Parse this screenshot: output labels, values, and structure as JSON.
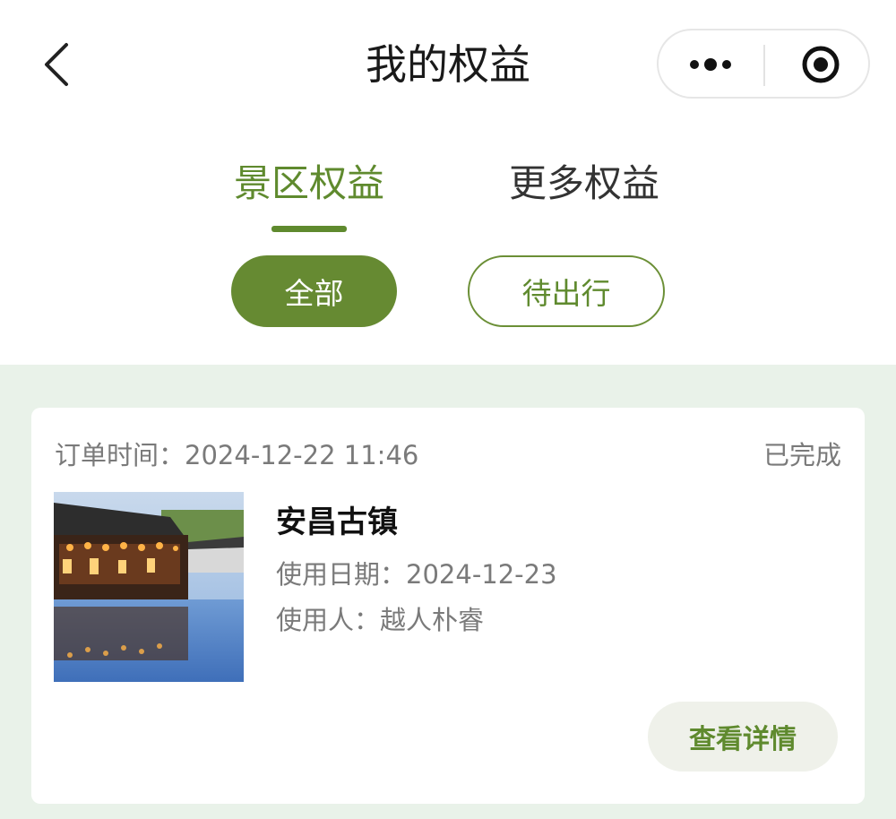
{
  "header": {
    "title": "我的权益",
    "back_icon": "chevron-left-icon",
    "more_icon": "more-dots-icon",
    "target_icon": "target-icon"
  },
  "tabs": [
    {
      "label": "景区权益",
      "active": true
    },
    {
      "label": "更多权益",
      "active": false
    }
  ],
  "filters": [
    {
      "label": "全部",
      "selected": true
    },
    {
      "label": "待出行",
      "selected": false
    }
  ],
  "colors": {
    "accent": "#5f8a2e",
    "pill_fill": "#668a32",
    "list_bg": "#e9f2e9"
  },
  "orders": [
    {
      "time_label": "订单时间：",
      "time_value": "2024-12-22 11:46",
      "status": "已完成",
      "name": "安昌古镇",
      "use_date_label": "使用日期：",
      "use_date_value": "2024-12-23",
      "user_label": "使用人：",
      "user_value": "越人朴睿",
      "detail_button": "查看详情"
    }
  ]
}
